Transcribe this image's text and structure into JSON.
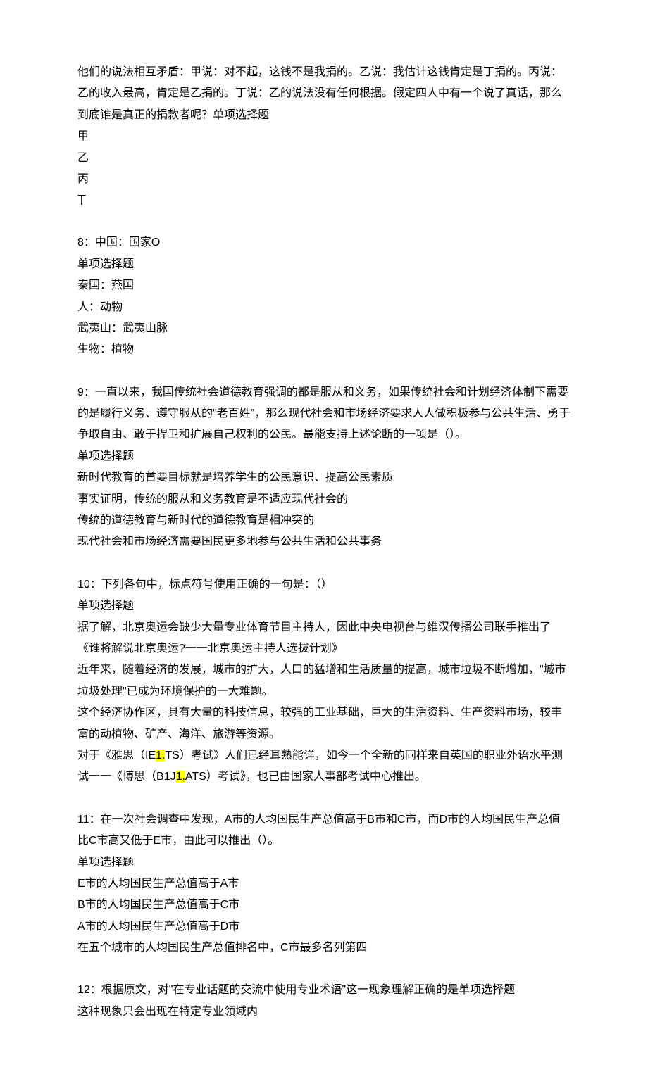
{
  "q7": {
    "stem": "他们的说法相互矛盾：甲说：对不起，这钱不是我捐的。乙说：我估计这钱肯定是丁捐的。丙说：乙的收入最高，肯定是乙捐的。丁说：乙的说法没有任何根据。假定四人中有一个说了真话，那么到底谁是真正的捐款者呢？单项选择题",
    "opts": [
      "甲",
      "乙",
      "丙",
      "T"
    ]
  },
  "q8": {
    "stem": "8：中国：国家O",
    "type": "单项选择题",
    "opts": [
      "秦国：燕国",
      "人：动物",
      "武夷山：武夷山脉",
      "生物：植物"
    ]
  },
  "q9": {
    "stem": "9：一直以来，我国传统社会道德教育强调的都是服从和义务，如果传统社会和计划经济体制下需要的是履行义务、遵守服从的\"老百姓\"，那么现代社会和市场经济要求人人做积极参与公共生活、勇于争取自由、敢于捍卫和扩展自己权利的公民。最能支持上述论断的一项是（）。",
    "type": "单项选择题",
    "opts": [
      "新时代教育的首要目标就是培养学生的公民意识、提高公民素质",
      "事实证明，传统的服从和义务教育是不适应现代社会的",
      "传统的道德教育与新时代的道德教育是相冲突的",
      "现代社会和市场经济需要国民更多地参与公共生活和公共事务"
    ]
  },
  "q10": {
    "stem": "10：下列各句中，标点符号使用正确的一句是：（）",
    "type": "单项选择题",
    "optA": "据了解，北京奥运会缺少大量专业体育节目主持人，因此中央电视台与维汉传播公司联手推出了《谁将解说北京奥运?一一北京奥运主持人选拔计划》",
    "optB": "近年来，随着经济的发展，城市的扩大，人口的猛增和生活质量的提高，城市垃圾不断增加，\"城市垃圾处理\"已成为环境保护的一大难题。",
    "optC": "这个经济协作区，具有大量的科技信息，较强的工业基础，巨大的生活资料、生产资料市场，较丰富的动植物、矿产、海洋、旅游等资源。",
    "optD_pre1": "对于《雅思（IE",
    "optD_hl1": "1.",
    "optD_mid": "TS）考试》人们已经耳熟能详，如今一个全新的同样来自英国的职业外语水平测试一一《博思（B1J",
    "optD_hl2": "1.",
    "optD_post": "ATS）考试》，也已由国家人事部考试中心推出。"
  },
  "q11": {
    "stem": "11：在一次社会调查中发现，A市的人均国民生产总值高于B市和C市，而D市的人均国民生产总值比C市高又低于E市，由此可以推出（）。",
    "type": "单项选择题",
    "opts": [
      "E市的人均国民生产总值高于A市",
      "B市的人均国民生产总值高于C市",
      "A市的人均国民生产总值高于D市",
      "在五个城市的人均国民生产总值排名中，C市最多名列第四"
    ]
  },
  "q12": {
    "stem": "12：根据原文，对\"在专业话题的交流中使用专业术语\"这一现象理解正确的是单项选择题",
    "optA": "这种现象只会出现在特定专业领域内"
  }
}
